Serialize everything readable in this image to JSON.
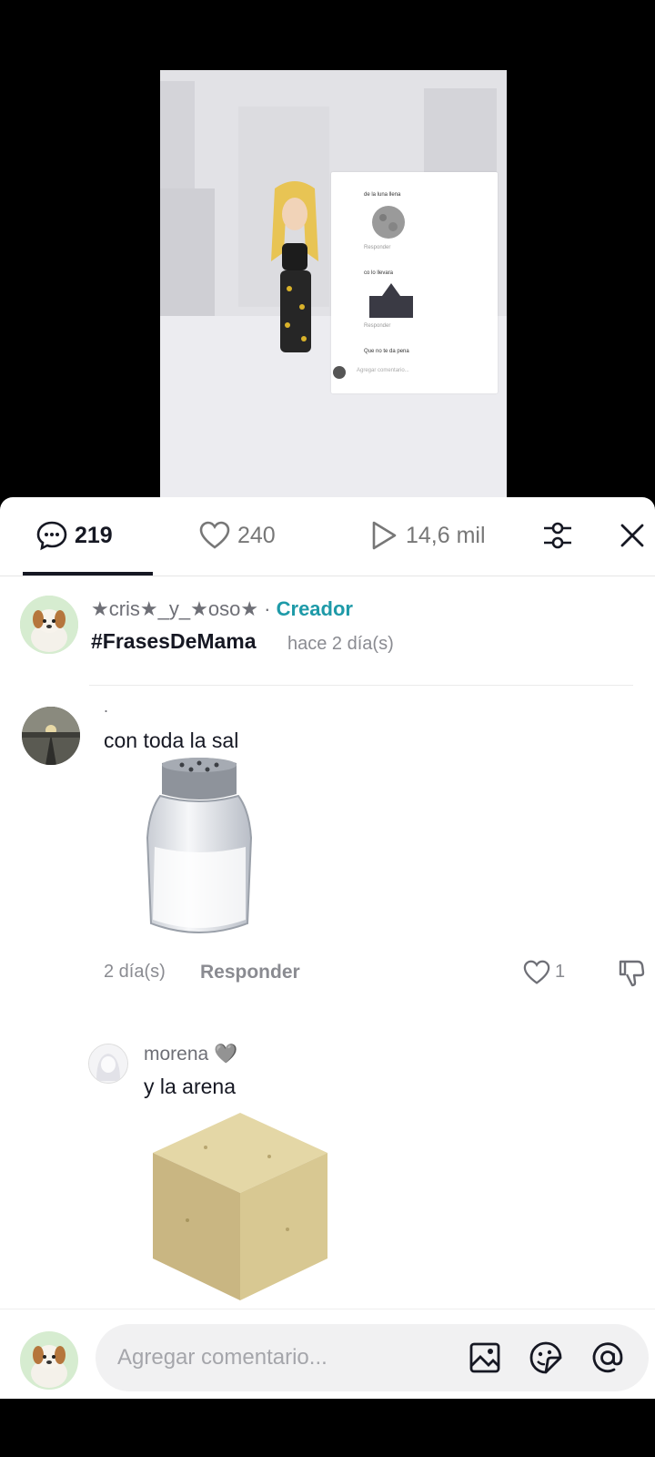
{
  "video": {
    "mini_panel": {
      "line1": "de la luna llena",
      "line2": "co lo llevara",
      "line3": "Que no te da pena",
      "reply": "Responder",
      "placeholder": "Agregar comentario..."
    }
  },
  "tabs": {
    "comments_count": "219",
    "likes_count": "240",
    "plays_count": "14,6 mil"
  },
  "creator_post": {
    "username": "★cris★_y_★oso★",
    "separator": "·",
    "role": "Creador",
    "caption": "#FrasesDeMama",
    "time": "hace 2 día(s)"
  },
  "comments": [
    {
      "username": ".",
      "text": "con toda la sal",
      "time": "2 día(s)",
      "reply_label": "Responder",
      "likes": "1",
      "sticker": "salt-shaker"
    },
    {
      "username": "morena 🩶",
      "text": "y la arena",
      "sticker": "sand-block"
    }
  ],
  "composer": {
    "placeholder": "Agregar comentario..."
  },
  "colors": {
    "accent": "#1e9aa8",
    "text": "#161823",
    "muted": "#8a8b91",
    "sheet": "#ffffff"
  }
}
